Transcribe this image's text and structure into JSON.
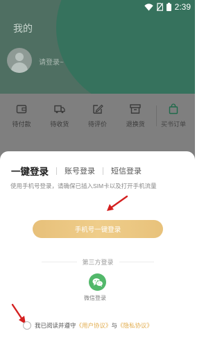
{
  "status_bar": {
    "time": "2:39"
  },
  "profile": {
    "page_title": "我的",
    "login_prompt": "请登录~"
  },
  "orders": [
    {
      "label": "待付款",
      "icon": "wallet-icon"
    },
    {
      "label": "待收货",
      "icon": "truck-icon"
    },
    {
      "label": "待评价",
      "icon": "edit-icon"
    },
    {
      "label": "退换货",
      "icon": "box-icon"
    },
    {
      "label": "买书订单",
      "icon": "bag-icon"
    }
  ],
  "login_sheet": {
    "tabs": [
      "一键登录",
      "账号登录",
      "短信登录"
    ],
    "active_tab": "一键登录",
    "hint": "使用手机号登录，请确保已插入SIM卡以及打开手机流量",
    "one_click_button": "手机号一键登录",
    "third_party_title": "第三方登录",
    "wechat_label": "微信登录",
    "agreement": {
      "prefix": "我已阅读并遵守",
      "user_agreement": "《用户协议》",
      "conjunction": "与",
      "privacy_policy": "《隐私协议》",
      "checked": false
    }
  },
  "colors": {
    "header": "#4f6f62",
    "overlay": "#7f7f7f",
    "primary_gold": "#e9c27c",
    "link_gold": "#e2ad4f",
    "wechat_green": "#52b86a",
    "annotation_red": "#d42020"
  }
}
